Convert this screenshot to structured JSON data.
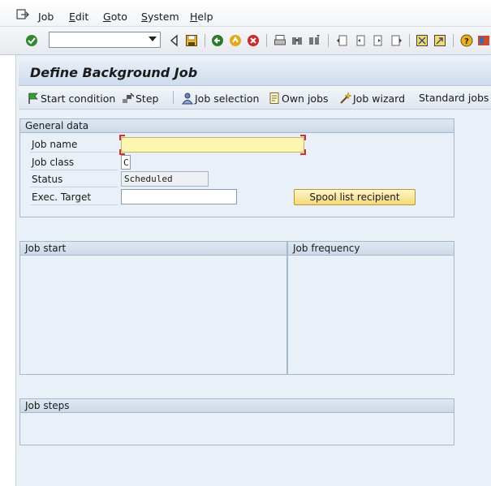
{
  "menu": {
    "items": [
      "Job",
      "Edit",
      "Goto",
      "System",
      "Help"
    ],
    "hotkeys": [
      "J",
      "E",
      "G",
      "S",
      "H"
    ]
  },
  "toolbar": {
    "command_value": "",
    "icons": [
      "enter-icon",
      "back-icon",
      "save-icon",
      "back-icon",
      "exit-icon",
      "cancel-icon",
      "print-icon",
      "find-icon",
      "find-next-icon",
      "first-page-icon",
      "previous-page-icon",
      "next-page-icon",
      "last-page-icon",
      "create-session-icon",
      "shortcut-icon",
      "help-icon",
      "customize-layout-icon"
    ]
  },
  "screen": {
    "title": "Define Background Job"
  },
  "app_toolbar": {
    "start_condition": "Start condition",
    "step": "Step",
    "job_selection": "Job selection",
    "own_jobs": "Own jobs",
    "job_wizard": "Job wizard",
    "standard_jobs": "Standard jobs"
  },
  "general_data": {
    "heading": "General data",
    "job_name_label": "Job name",
    "job_name_value": "",
    "job_class_label": "Job class",
    "job_class_value": "C",
    "status_label": "Status",
    "status_value": "Scheduled",
    "exec_target_label": "Exec. Target",
    "exec_target_value": "",
    "spool_button": "Spool list recipient"
  },
  "job_start": {
    "heading": "Job start"
  },
  "job_frequency": {
    "heading": "Job frequency"
  },
  "job_steps": {
    "heading": "Job steps"
  },
  "colors": {
    "required_field": "#fdf6b1",
    "screen_bg": "#e9f0f7",
    "button_yellow": "#f5d97b"
  }
}
